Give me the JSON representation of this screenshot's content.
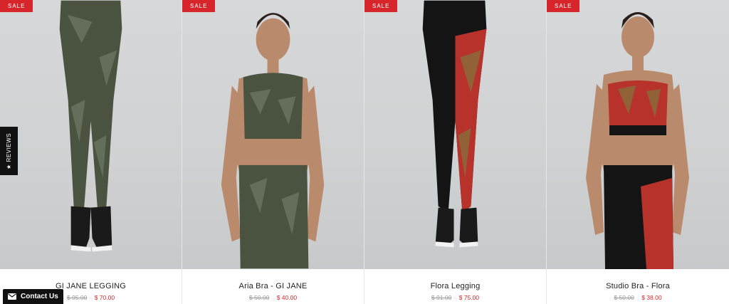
{
  "products": [
    {
      "badge": "SALE",
      "title": "GI JANE LEGGING",
      "old_price": "$ 95.00",
      "sale_price": "$ 70.00"
    },
    {
      "badge": "SALE",
      "title": "Aria Bra - GI JANE",
      "old_price": "$ 50.00",
      "sale_price": "$ 40.00"
    },
    {
      "badge": "SALE",
      "title": "Flora Legging",
      "old_price": "$ 91.00",
      "sale_price": "$ 75.00"
    },
    {
      "badge": "SALE",
      "title": "Studio Bra - Flora",
      "old_price": "$ 50.00",
      "sale_price": "$ 38.00"
    }
  ],
  "reviews_tab": {
    "label": "REVIEWS",
    "icon": "star-icon"
  },
  "contact_button": {
    "label": "Contact Us",
    "icon": "envelope-icon"
  },
  "colors": {
    "sale_badge": "#d6262b",
    "sale_price": "#d6262b",
    "dark_widget": "#111111"
  }
}
